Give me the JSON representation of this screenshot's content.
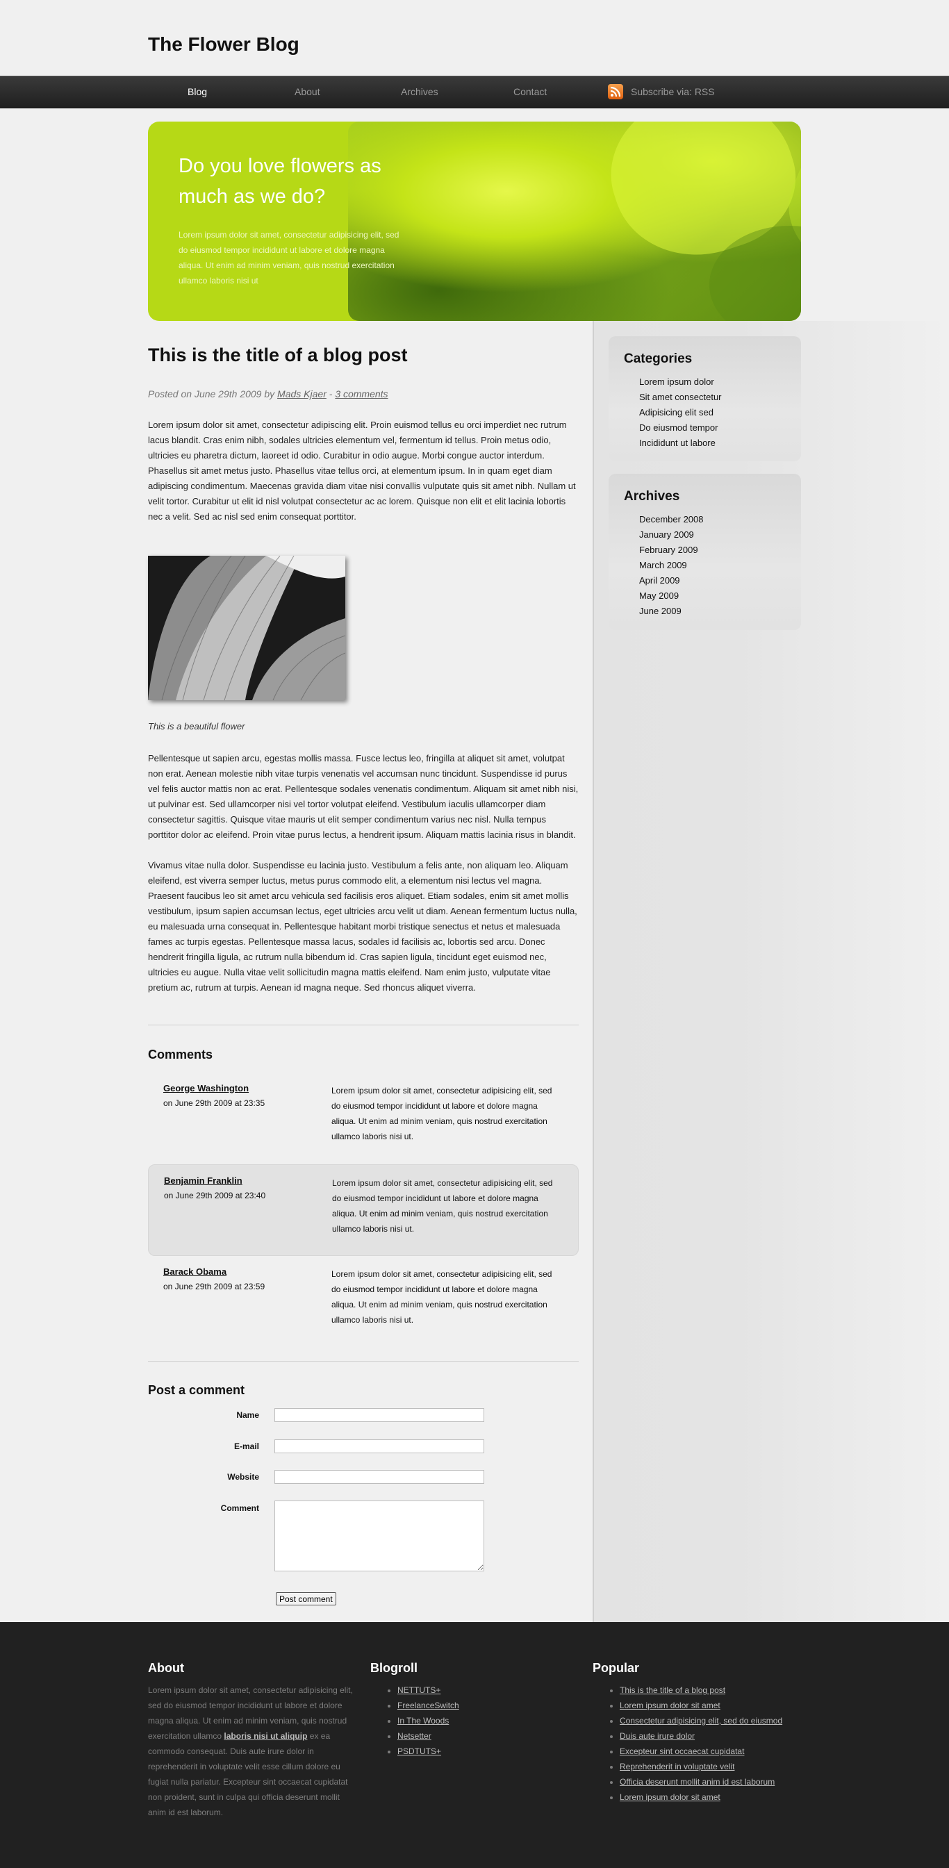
{
  "site": {
    "title": "The Flower Blog"
  },
  "nav": {
    "items": [
      "Blog",
      "About",
      "Archives",
      "Contact"
    ],
    "active": "Blog",
    "rss_label": "Subscribe via: RSS",
    "rss_icon": "rss-icon"
  },
  "hero": {
    "heading": "Do you love flowers as much as we do?",
    "text": "Lorem ipsum dolor sit amet, consectetur adipisicing elit, sed do eiusmod tempor incididunt ut labore et dolore magna aliqua. Ut enim ad minim veniam, quis nostrud exercitation ullamco laboris nisi ut"
  },
  "post": {
    "title": "This is the title of a blog post",
    "meta_prefix": "Posted on June 29th 2009 by",
    "author": "Mads Kjaer",
    "meta_sep": "-",
    "comments_link": "3 comments",
    "para1": "Lorem ipsum dolor sit amet, consectetur adipiscing elit. Proin euismod tellus eu orci imperdiet nec rutrum lacus blandit. Cras enim nibh, sodales ultricies elementum vel, fermentum id tellus. Proin metus odio, ultricies eu pharetra dictum, laoreet id odio. Curabitur in odio augue. Morbi congue auctor interdum. Phasellus sit amet metus justo. Phasellus vitae tellus orci, at elementum ipsum. In in quam eget diam adipiscing condimentum. Maecenas gravida diam vitae nisi convallis vulputate quis sit amet nibh. Nullam ut velit tortor. Curabitur ut elit id nisl volutpat consectetur ac ac lorem. Quisque non elit et elit lacinia lobortis nec a velit. Sed ac nisl sed enim consequat porttitor.",
    "caption": "This is a beautiful flower",
    "para2": "Pellentesque ut sapien arcu, egestas mollis massa. Fusce lectus leo, fringilla at aliquet sit amet, volutpat non erat. Aenean molestie nibh vitae turpis venenatis vel accumsan nunc tincidunt. Suspendisse id purus vel felis auctor mattis non ac erat. Pellentesque sodales venenatis condimentum. Aliquam sit amet nibh nisi, ut pulvinar est. Sed ullamcorper nisi vel tortor volutpat eleifend. Vestibulum iaculis ullamcorper diam consectetur sagittis. Quisque vitae mauris ut elit semper condimentum varius nec nisl. Nulla tempus porttitor dolor ac eleifend. Proin vitae purus lectus, a hendrerit ipsum. Aliquam mattis lacinia risus in blandit.",
    "para3": "Vivamus vitae nulla dolor. Suspendisse eu lacinia justo. Vestibulum a felis ante, non aliquam leo. Aliquam eleifend, est viverra semper luctus, metus purus commodo elit, a elementum nisi lectus vel magna. Praesent faucibus leo sit amet arcu vehicula sed facilisis eros aliquet. Etiam sodales, enim sit amet mollis vestibulum, ipsum sapien accumsan lectus, eget ultricies arcu velit ut diam. Aenean fermentum luctus nulla, eu malesuada urna consequat in. Pellentesque habitant morbi tristique senectus et netus et malesuada fames ac turpis egestas. Pellentesque massa lacus, sodales id facilisis ac, lobortis sed arcu. Donec hendrerit fringilla ligula, ac rutrum nulla bibendum id. Cras sapien ligula, tincidunt eget euismod nec, ultricies eu augue. Nulla vitae velit sollicitudin magna mattis eleifend. Nam enim justo, vulputate vitae pretium ac, rutrum at turpis. Aenean id magna neque. Sed rhoncus aliquet viverra."
  },
  "comments": {
    "title": "Comments",
    "items": [
      {
        "author": "George Washington",
        "date": "on June 29th 2009 at 23:35",
        "text": "Lorem ipsum dolor sit amet, consectetur adipisicing elit, sed do eiusmod tempor incididunt ut labore et dolore magna aliqua. Ut enim ad minim veniam, quis nostrud exercitation ullamco laboris nisi ut."
      },
      {
        "author": "Benjamin Franklin",
        "date": "on June 29th 2009 at 23:40",
        "text": "Lorem ipsum dolor sit amet, consectetur adipisicing elit, sed do eiusmod tempor incididunt ut labore et dolore magna aliqua. Ut enim ad minim veniam, quis nostrud exercitation ullamco laboris nisi ut."
      },
      {
        "author": "Barack Obama",
        "date": "on June 29th 2009 at 23:59",
        "text": "Lorem ipsum dolor sit amet, consectetur adipisicing elit, sed do eiusmod tempor incididunt ut labore et dolore magna aliqua. Ut enim ad minim veniam, quis nostrud exercitation ullamco laboris nisi ut."
      }
    ]
  },
  "form": {
    "title": "Post a comment",
    "name_label": "Name",
    "email_label": "E-mail",
    "website_label": "Website",
    "comment_label": "Comment",
    "submit_label": "Post comment"
  },
  "sidebar": {
    "categories": {
      "title": "Categories",
      "items": [
        "Lorem ipsum dolor",
        "Sit amet consectetur",
        "Adipisicing elit sed",
        "Do eiusmod tempor",
        "Incididunt ut labore"
      ]
    },
    "archives": {
      "title": "Archives",
      "items": [
        "December 2008",
        "January 2009",
        "February 2009",
        "March 2009",
        "April 2009",
        "May 2009",
        "June 2009"
      ]
    }
  },
  "footer": {
    "about": {
      "title": "About",
      "text_before": "Lorem ipsum dolor sit amet, consectetur adipisicing elit, sed do eiusmod tempor incididunt ut labore et dolore magna aliqua. Ut enim ad minim veniam, quis nostrud exercitation ullamco",
      "link": "laboris nisi ut aliquip",
      "text_after": "ex ea commodo consequat. Duis aute irure dolor in reprehenderit in voluptate velit esse cillum dolore eu fugiat nulla pariatur. Excepteur sint occaecat cupidatat non proident, sunt in culpa qui officia deserunt mollit anim id est laborum."
    },
    "blogroll": {
      "title": "Blogroll",
      "items": [
        "NETTUTS+",
        "FreelanceSwitch",
        "In The Woods",
        "Netsetter",
        "PSDTUTS+"
      ]
    },
    "popular": {
      "title": "Popular",
      "items": [
        "This is the title of a blog post",
        "Lorem ipsum dolor sit amet",
        "Consectetur adipisicing elit, sed do eiusmod",
        "Duis aute irure dolor",
        "Excepteur sint occaecat cupidatat",
        "Reprehenderit in voluptate velit",
        "Officia deserunt mollit anim id est laborum",
        "Lorem ipsum dolor sit amet"
      ]
    }
  },
  "colors": {
    "page_bg": "#f0f0f0",
    "nav_bg": "#2a2a2a",
    "hero_green": "#b6d916",
    "footer_bg": "#212121",
    "rss_orange": "#e8761c"
  }
}
